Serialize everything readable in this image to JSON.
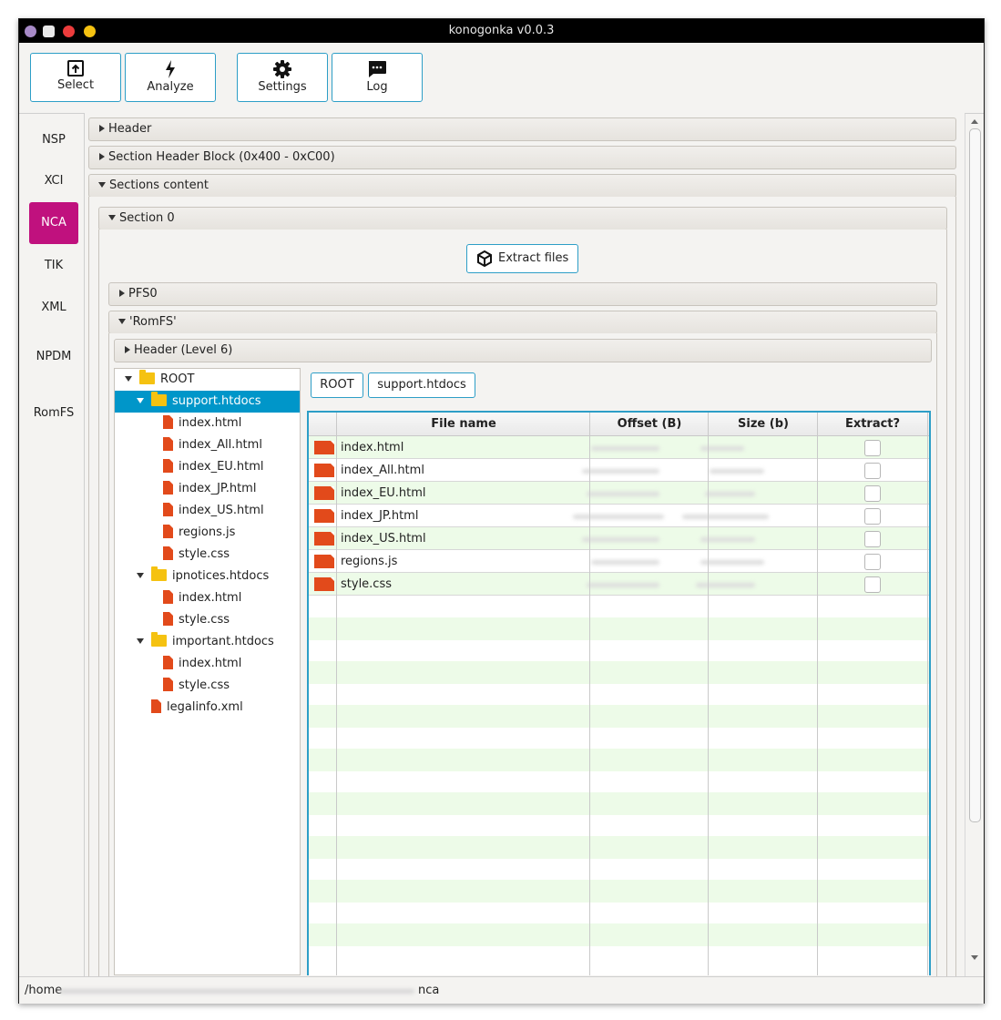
{
  "window": {
    "title": "konogonka v0.0.3"
  },
  "toolbar": {
    "select_label": "Select",
    "analyze_label": "Analyze",
    "settings_label": "Settings",
    "log_label": "Log"
  },
  "nav": {
    "items": [
      "NSP",
      "XCI",
      "NCA",
      "TIK",
      "XML",
      "NPDM",
      "RomFS"
    ],
    "active": "NCA"
  },
  "panes": {
    "header": "Header",
    "section_header_block": "Section Header Block (0x400 - 0xC00)",
    "sections_content": "Sections content",
    "section0": "Section 0",
    "extract_files": "Extract files",
    "pfs0": "PFS0",
    "romfs": "'RomFS'",
    "header_level6": "Header (Level 6)"
  },
  "tree": {
    "root": "ROOT",
    "folder1": "support.htdocs",
    "folder1_files": [
      "index.html",
      "index_All.html",
      "index_EU.html",
      "index_JP.html",
      "index_US.html",
      "regions.js",
      "style.css"
    ],
    "folder2": "ipnotices.htdocs",
    "folder2_files": [
      "index.html",
      "style.css"
    ],
    "folder3": "important.htdocs",
    "folder3_files": [
      "index.html",
      "style.css"
    ],
    "root_file": "legalinfo.xml"
  },
  "breadcrumbs": [
    "ROOT",
    "support.htdocs"
  ],
  "table": {
    "columns": [
      "File name",
      "Offset (B)",
      "Size (b)",
      "Extract?"
    ],
    "rows": [
      "index.html",
      "index_All.html",
      "index_EU.html",
      "index_JP.html",
      "index_US.html",
      "regions.js",
      "style.css"
    ]
  },
  "status": {
    "path_prefix": "/home",
    "path_suffix": "nca"
  },
  "colors": {
    "accent": "#2d9ec7",
    "nav_active": "#c0117e",
    "tree_selected": "#0096c9",
    "file_icon": "#e24a1b",
    "folder_icon": "#f5c211",
    "row_stripe": "#edfbe8"
  }
}
